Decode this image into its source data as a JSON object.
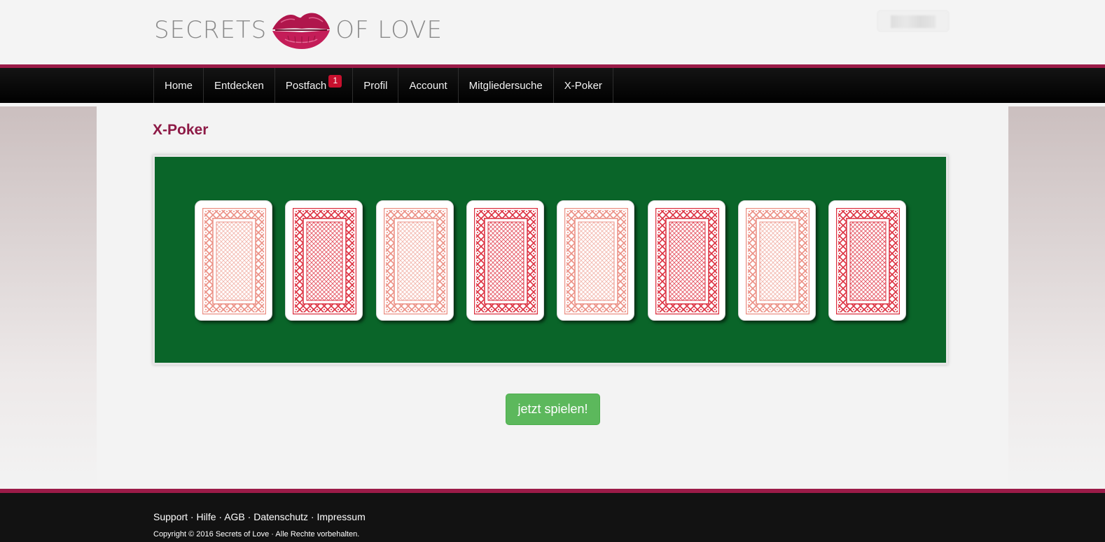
{
  "header": {
    "logo_left": "SECRETS",
    "logo_right": "OF LOVE",
    "logo_icon": "lips-icon",
    "brand_color": "#9b1b48"
  },
  "nav": {
    "items": [
      {
        "label": "Home"
      },
      {
        "label": "Entdecken"
      },
      {
        "label": "Postfach",
        "badge": "1"
      },
      {
        "label": "Profil"
      },
      {
        "label": "Account"
      },
      {
        "label": "Mitgliedersuche"
      },
      {
        "label": "X-Poker"
      }
    ]
  },
  "page": {
    "title": "X-Poker"
  },
  "game": {
    "table_color": "#0a6529",
    "cards": [
      {
        "back": "light"
      },
      {
        "back": "dark"
      },
      {
        "back": "light"
      },
      {
        "back": "dark"
      },
      {
        "back": "light"
      },
      {
        "back": "dark"
      },
      {
        "back": "light"
      },
      {
        "back": "dark"
      }
    ],
    "play_button": "jetzt spielen!"
  },
  "footer": {
    "links": [
      "Support",
      "Hilfe",
      "AGB",
      "Datenschutz",
      "Impressum"
    ],
    "separator": " · ",
    "copyright": "Copyright © 2016 Secrets of Love · Alle Rechte vorbehalten."
  }
}
